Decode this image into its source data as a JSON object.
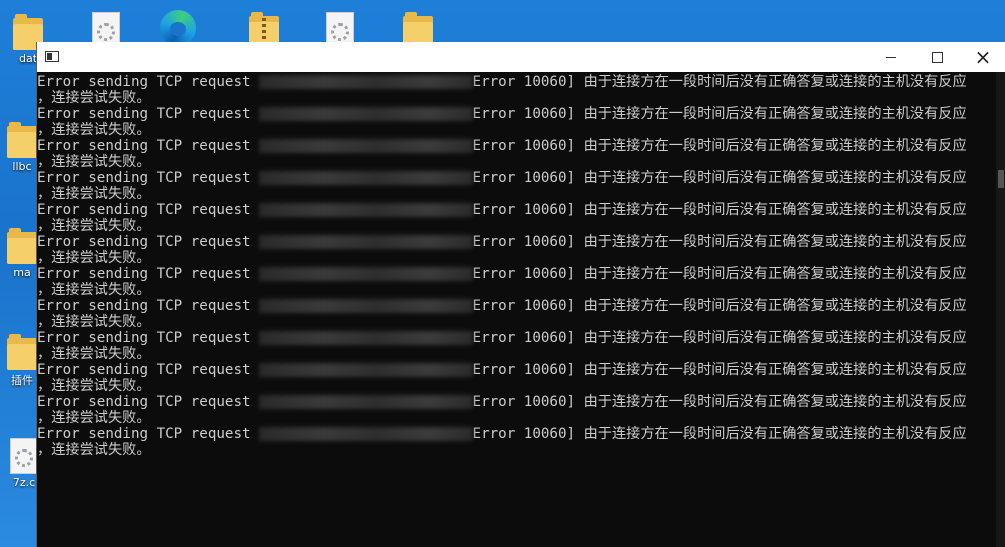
{
  "desktop": {
    "icons": [
      {
        "label": "dat",
        "kind": "folder"
      },
      {
        "label": "",
        "kind": "file"
      },
      {
        "label": "",
        "kind": "edge"
      },
      {
        "label": "",
        "kind": "zip-folder"
      },
      {
        "label": "",
        "kind": "file"
      },
      {
        "label": "",
        "kind": "folder"
      },
      {
        "label": "llbc",
        "kind": "folder"
      },
      {
        "label": "ma",
        "kind": "folder"
      },
      {
        "label": "插件",
        "kind": "folder"
      },
      {
        "label": "7z.c",
        "kind": "file"
      }
    ]
  },
  "window": {
    "icon": "console-app-icon",
    "controls": {
      "minimize": "minimize-icon",
      "maximize": "maximize-icon",
      "close": "×"
    }
  },
  "console": {
    "lines": [
      {
        "prefix": "Error sending TCP request",
        "suffix": "Error 10060] ",
        "message": "由于连接方在一段时间后没有正确答复或连接的主机没有反应",
        "continuation": "，连接尝试失败。"
      },
      {
        "prefix": "Error sending TCP request",
        "suffix": "Error 10060] ",
        "message": "由于连接方在一段时间后没有正确答复或连接的主机没有反应",
        "continuation": "，连接尝试失败。"
      },
      {
        "prefix": "Error sending TCP request",
        "suffix": "Error 10060] ",
        "message": "由于连接方在一段时间后没有正确答复或连接的主机没有反应",
        "continuation": "，连接尝试失败。"
      },
      {
        "prefix": "Error sending TCP request",
        "suffix": "Error 10060] ",
        "message": "由于连接方在一段时间后没有正确答复或连接的主机没有反应",
        "continuation": "，连接尝试失败。"
      },
      {
        "prefix": "Error sending TCP request",
        "suffix": "Error 10060] ",
        "message": "由于连接方在一段时间后没有正确答复或连接的主机没有反应",
        "continuation": "，连接尝试失败。"
      },
      {
        "prefix": "Error sending TCP request",
        "suffix": "Error 10060] ",
        "message": "由于连接方在一段时间后没有正确答复或连接的主机没有反应",
        "continuation": "，连接尝试失败。"
      },
      {
        "prefix": "Error sending TCP request",
        "suffix": "Error 10060] ",
        "message": "由于连接方在一段时间后没有正确答复或连接的主机没有反应",
        "continuation": "，连接尝试失败。"
      },
      {
        "prefix": "Error sending TCP request",
        "suffix": "Error 10060] ",
        "message": "由于连接方在一段时间后没有正确答复或连接的主机没有反应",
        "continuation": "，连接尝试失败。"
      },
      {
        "prefix": "Error sending TCP request",
        "suffix": "Error 10060] ",
        "message": "由于连接方在一段时间后没有正确答复或连接的主机没有反应",
        "continuation": "，连接尝试失败。"
      },
      {
        "prefix": "Error sending TCP request",
        "suffix": "Error 10060] ",
        "message": "由于连接方在一段时间后没有正确答复或连接的主机没有反应",
        "continuation": "，连接尝试失败。"
      },
      {
        "prefix": "Error sending TCP request",
        "suffix": "Error 10060] ",
        "message": "由于连接方在一段时间后没有正确答复或连接的主机没有反应",
        "continuation": "，连接尝试失败。"
      },
      {
        "prefix": "Error sending TCP request",
        "suffix": "Error 10060] ",
        "message": "由于连接方在一段时间后没有正确答复或连接的主机没有反应",
        "continuation": "，连接尝试失败。"
      }
    ]
  },
  "colors": {
    "console_bg": "#0c0c0c",
    "console_text": "#cccccc",
    "desktop_bg": "#1a73cc",
    "titlebar_bg": "#ffffff"
  }
}
